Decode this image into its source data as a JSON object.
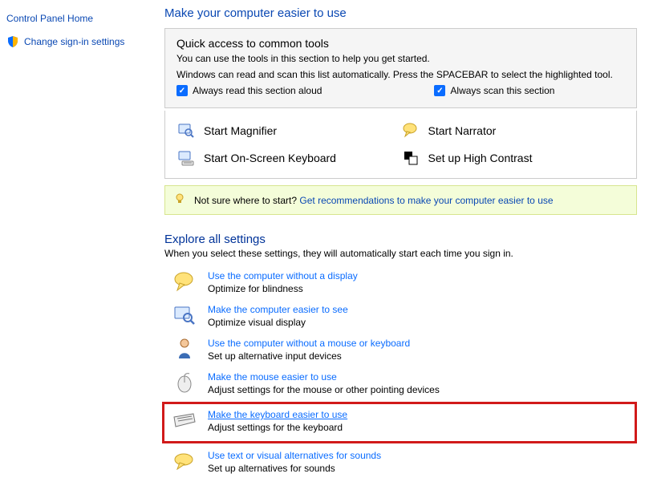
{
  "sidebar": {
    "home": "Control Panel Home",
    "signin": "Change sign-in settings"
  },
  "header": "Make your computer easier to use",
  "quick": {
    "title": "Quick access to common tools",
    "line1": "You can use the tools in this section to help you get started.",
    "line2": "Windows can read and scan this list automatically.  Press the SPACEBAR to select the highlighted tool.",
    "check1": "Always read this section aloud",
    "check2": "Always scan this section"
  },
  "tools": {
    "magnifier": "Start Magnifier",
    "narrator": "Start Narrator",
    "osk": "Start On-Screen Keyboard",
    "contrast": "Set up High Contrast"
  },
  "infobar": {
    "prefix": "Not sure where to start? ",
    "link": "Get recommendations to make your computer easier to use"
  },
  "explore": {
    "title": "Explore all settings",
    "desc": "When you select these settings, they will automatically start each time you sign in."
  },
  "items": [
    {
      "title": "Use the computer without a display",
      "desc": "Optimize for blindness"
    },
    {
      "title": "Make the computer easier to see",
      "desc": "Optimize visual display"
    },
    {
      "title": "Use the computer without a mouse or keyboard",
      "desc": "Set up alternative input devices"
    },
    {
      "title": "Make the mouse easier to use",
      "desc": "Adjust settings for the mouse or other pointing devices"
    },
    {
      "title": "Make the keyboard easier to use",
      "desc": "Adjust settings for the keyboard"
    },
    {
      "title": "Use text or visual alternatives for sounds",
      "desc": "Set up alternatives for sounds"
    }
  ]
}
